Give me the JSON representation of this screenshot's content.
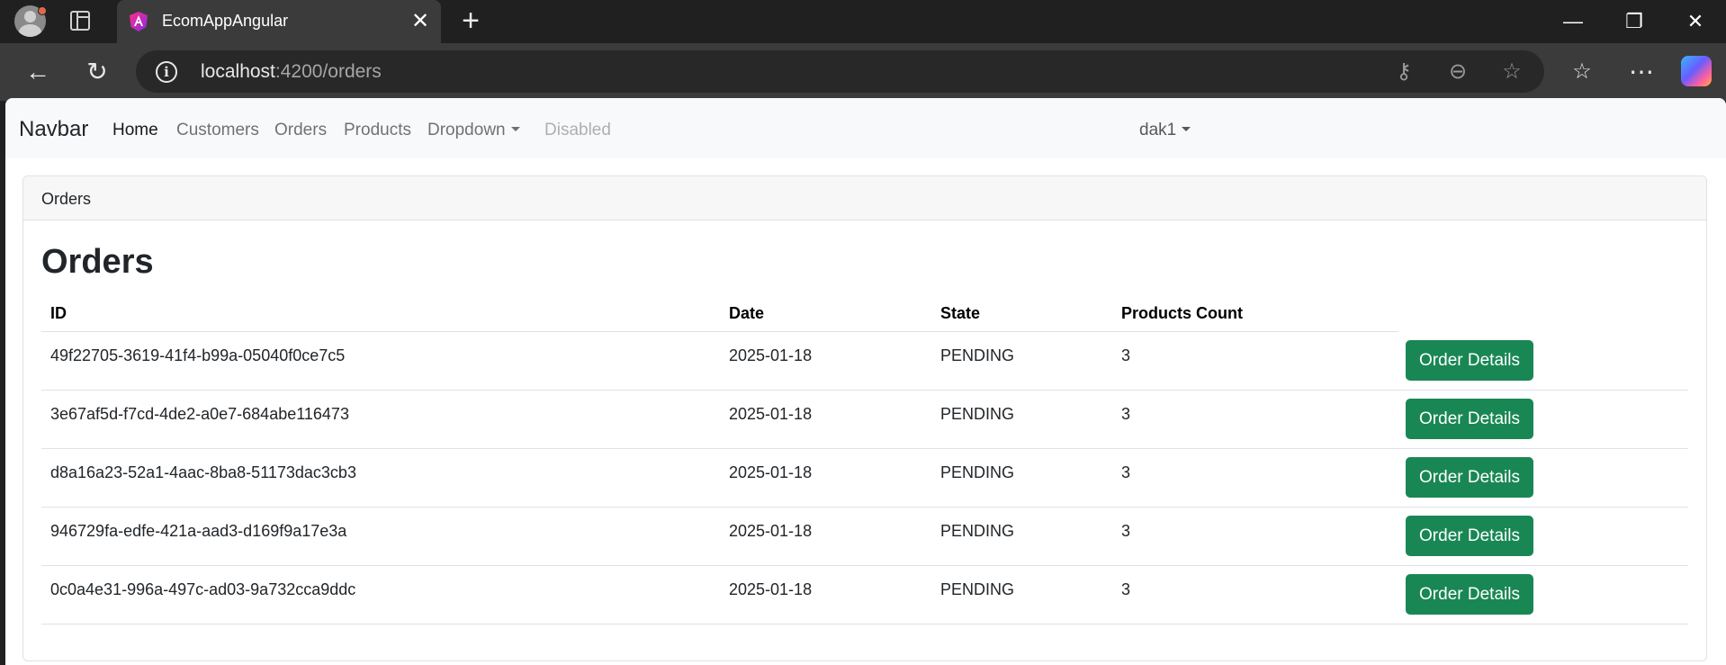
{
  "browser": {
    "tab_title": "EcomAppAngular",
    "url_host": "localhost",
    "url_path": ":4200/orders"
  },
  "navbar": {
    "brand": "Navbar",
    "links": [
      {
        "label": "Home",
        "state": "active"
      },
      {
        "label": "Customers",
        "state": "normal"
      },
      {
        "label": "Orders",
        "state": "normal"
      },
      {
        "label": "Products",
        "state": "normal"
      },
      {
        "label": "Dropdown",
        "state": "dropdown"
      },
      {
        "label": "Disabled",
        "state": "disabled"
      }
    ],
    "user": "dak1"
  },
  "card": {
    "header": "Orders",
    "title": "Orders"
  },
  "table": {
    "columns": [
      "ID",
      "Date",
      "State",
      "Products Count"
    ],
    "button_label": "Order Details",
    "rows": [
      {
        "id": "49f22705-3619-41f4-b99a-05040f0ce7c5",
        "date": "2025-01-18",
        "state": "PENDING",
        "count": "3"
      },
      {
        "id": "3e67af5d-f7cd-4de2-a0e7-684abe116473",
        "date": "2025-01-18",
        "state": "PENDING",
        "count": "3"
      },
      {
        "id": "d8a16a23-52a1-4aac-8ba8-51173dac3cb3",
        "date": "2025-01-18",
        "state": "PENDING",
        "count": "3"
      },
      {
        "id": "946729fa-edfe-421a-aad3-d169f9a17e3a",
        "date": "2025-01-18",
        "state": "PENDING",
        "count": "3"
      },
      {
        "id": "0c0a4e31-996a-497c-ad03-9a732cca9ddc",
        "date": "2025-01-18",
        "state": "PENDING",
        "count": "3"
      }
    ]
  },
  "colors": {
    "success": "#198754",
    "chrome_dark": "#202020",
    "chrome_toolbar": "#3b3b3b",
    "navbar_bg": "#f8f9fa"
  },
  "icons": {
    "profile": "profile-avatar-icon",
    "tab_actions": "tab-actions-icon",
    "favicon": "angular-icon",
    "close": "close-icon",
    "new_tab": "plus-icon",
    "back": "back-arrow-icon",
    "refresh": "refresh-icon",
    "site_info": "info-icon",
    "password": "key-icon",
    "zoom": "zoom-out-icon",
    "favorite": "star-icon",
    "favorites": "favorites-icon",
    "more": "more-icon",
    "copilot": "copilot-icon"
  }
}
